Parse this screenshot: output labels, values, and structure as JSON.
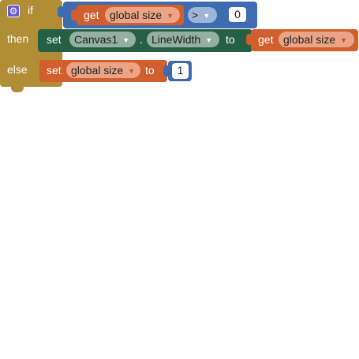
{
  "if_block": {
    "if_label": "if",
    "then_label": "then",
    "else_label": "else",
    "mutator_icon": "gear-icon"
  },
  "condition": {
    "left": {
      "get_label": "get",
      "variable": "global size"
    },
    "operator": ">",
    "right_value": "0"
  },
  "then_statement": {
    "set_label": "set",
    "component": "Canvas1",
    "separator": ".",
    "property": "LineWidth",
    "to_label": "to",
    "value": {
      "get_label": "get",
      "variable": "global size"
    }
  },
  "else_statement": {
    "set_label": "set",
    "variable": "global size",
    "to_label": "to",
    "value": "1"
  },
  "colors": {
    "control": "#b18e35",
    "logic_math": "#3f6bb0",
    "variables": "#d05f2d",
    "component_setter": "#266044"
  }
}
